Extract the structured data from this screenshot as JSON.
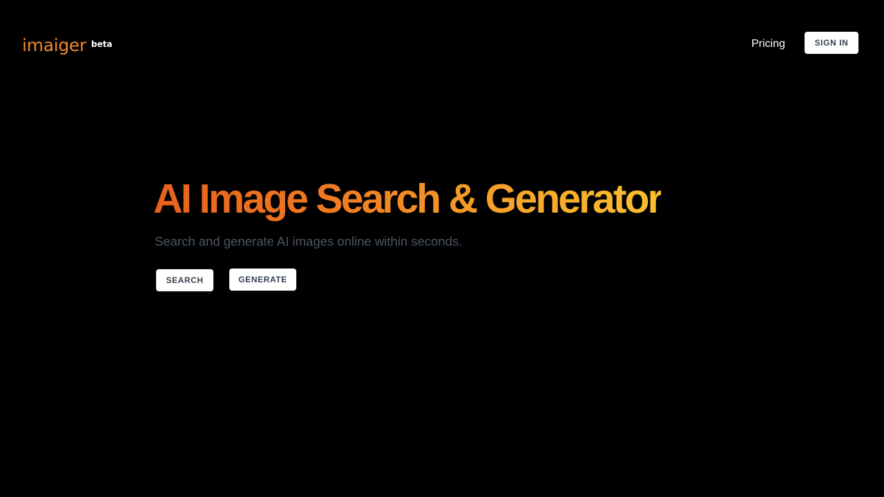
{
  "header": {
    "logo": {
      "wordmark": "imaiger",
      "badge": "beta"
    },
    "nav": {
      "pricing_label": "Pricing",
      "sign_in_label": "SIGN IN"
    }
  },
  "hero": {
    "title": "AI Image Search & Generator",
    "subtitle": "Search and generate AI images online within seconds.",
    "search_label": "SEARCH",
    "generate_label": "GENERATE"
  },
  "colors": {
    "background": "#000000",
    "brand_orange": "#f08a2e",
    "gradient_start": "#e8611c",
    "gradient_end": "#fbbf2f",
    "subtitle_gray": "#4b5563",
    "button_bg": "#ffffff",
    "button_text": "#374151"
  }
}
